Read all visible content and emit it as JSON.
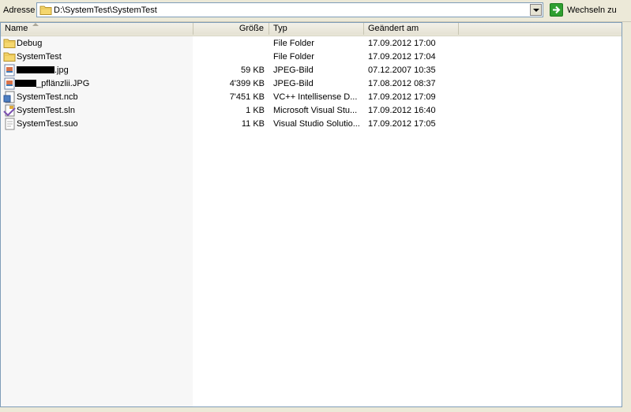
{
  "address_bar": {
    "label": "Adresse",
    "path": "D:\\SystemTest\\SystemTest",
    "go_label": "Wechseln zu"
  },
  "columns": {
    "name": "Name",
    "size": "Größe",
    "type": "Typ",
    "modified": "Geändert am"
  },
  "files": [
    {
      "name": "Debug",
      "size": "",
      "type": "File Folder",
      "modified": "17.09.2012 17:00",
      "icon": "folder-icon"
    },
    {
      "name": "SystemTest",
      "size": "",
      "type": "File Folder",
      "modified": "17.09.2012 17:04",
      "icon": "folder-icon"
    },
    {
      "name": ".jpg",
      "size": "59 KB",
      "type": "JPEG-Bild",
      "modified": "07.12.2007 10:35",
      "icon": "jpeg-image-icon"
    },
    {
      "name": "_pflänzlii.JPG",
      "size": "4'399 KB",
      "type": "JPEG-Bild",
      "modified": "17.08.2012 08:37",
      "icon": "jpeg-image-icon"
    },
    {
      "name": "SystemTest.ncb",
      "size": "7'451 KB",
      "type": "VC++ Intellisense D...",
      "modified": "17.09.2012 17:09",
      "icon": "ncb-file-icon"
    },
    {
      "name": "SystemTest.sln",
      "size": "1 KB",
      "type": "Microsoft Visual Stu...",
      "modified": "17.09.2012 16:40",
      "icon": "solution-file-icon"
    },
    {
      "name": "SystemTest.suo",
      "size": "11 KB",
      "type": "Visual Studio Solutio...",
      "modified": "17.09.2012 17:05",
      "icon": "suo-file-icon"
    }
  ],
  "colors": {
    "chrome": "#ece9d8",
    "sorted_column": "#f7f7f7",
    "folder": "#f5d76e",
    "go_green": "#2f9f30"
  }
}
